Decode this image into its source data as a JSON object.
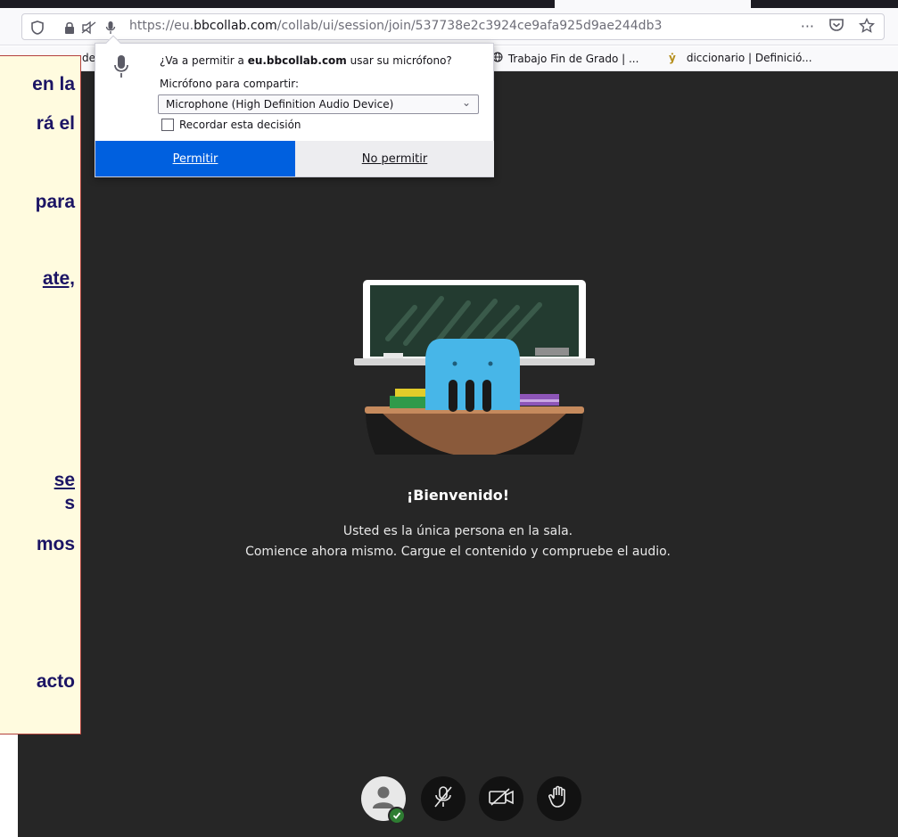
{
  "browser": {
    "url": "https://eu.bbcollab.com/collab/ui/session/join/537738e2c3924ce9afa925d9ae244db3",
    "url_prefix": "https://eu.",
    "url_domain": "bbcollab.com",
    "url_path": "/collab/ui/session/join/537738e2c3924ce9afa925d9ae244db3",
    "page_actions_icon": "ellipsis-icon",
    "bookmarks": [
      {
        "label": "de",
        "icon": "folder-icon"
      },
      {
        "label": "Trabajo Fin de Grado | ...",
        "icon": "globe-icon"
      },
      {
        "label": "diccionario | Definició...",
        "icon": "bookmark-icon"
      }
    ]
  },
  "permission_prompt": {
    "question_prefix": "¿Va a permitir a ",
    "question_domain": "eu.bbcollab.com",
    "question_suffix": " usar su micrófono?",
    "share_label": "Micrófono para compartir:",
    "selected_device": "Microphone (High Definition Audio Device)",
    "remember_label": "Recordar esta decisión",
    "remember_checked": false,
    "allow_label": "Permitir",
    "deny_label": "No permitir"
  },
  "collab": {
    "welcome_title": "¡Bienvenido!",
    "welcome_line1": "Usted es la única persona en la sala.",
    "welcome_line2": "Comience ahora mismo. Cargue el contenido y compruebe el audio.",
    "controls": [
      {
        "name": "avatar",
        "icon": "user-icon"
      },
      {
        "name": "microphone",
        "icon": "microphone-muted-icon"
      },
      {
        "name": "camera",
        "icon": "camera-off-icon"
      },
      {
        "name": "raise-hand",
        "icon": "hand-icon"
      }
    ],
    "colors": {
      "background": "#262626",
      "accent": "#0060df",
      "check": "#2e7d32"
    }
  },
  "slide_overlay": {
    "lines": [
      {
        "text": "en la",
        "underline": false
      },
      {
        "text": "rá el",
        "underline": false
      },
      {
        "text": "para",
        "underline": false
      },
      {
        "text": "ate,",
        "underline": true
      },
      {
        "text": " se",
        "underline": true
      },
      {
        "text": "s",
        "underline": false
      },
      {
        "text": "mos",
        "underline": false
      },
      {
        "text": "acto",
        "underline": false
      }
    ]
  }
}
